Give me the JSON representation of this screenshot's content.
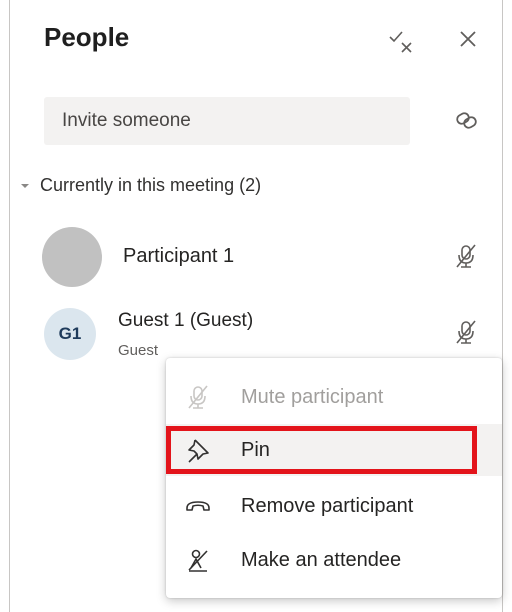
{
  "header": {
    "title": "People",
    "icons": [
      "mute-all-icon",
      "close-icon"
    ]
  },
  "invite": {
    "placeholder": "Invite someone",
    "icon": "share-link-icon"
  },
  "section": {
    "label": "Currently in this meeting (2)",
    "icon": "chevron-down-icon"
  },
  "participants": [
    {
      "name": "Participant 1",
      "role": "",
      "avatar_initials": "",
      "mic_icon": "mic-off-icon"
    },
    {
      "name": "Guest 1 (Guest)",
      "role": "Guest",
      "avatar_initials": "G1",
      "mic_icon": "mic-off-icon"
    }
  ],
  "context_menu": {
    "items": [
      {
        "label": "Mute participant",
        "icon": "mic-off-icon",
        "disabled": true
      },
      {
        "label": "Pin",
        "icon": "pin-icon",
        "disabled": false,
        "highlighted": true
      },
      {
        "label": "Remove participant",
        "icon": "hang-up-icon",
        "disabled": false
      },
      {
        "label": "Make an attendee",
        "icon": "make-attendee-icon",
        "disabled": false
      }
    ]
  },
  "colors": {
    "highlight_border": "#e3141b",
    "invite_bg": "#f3f2f1",
    "avatar_grey": "#c1c1c1",
    "avatar_g1_bg": "#dbe6ee"
  }
}
